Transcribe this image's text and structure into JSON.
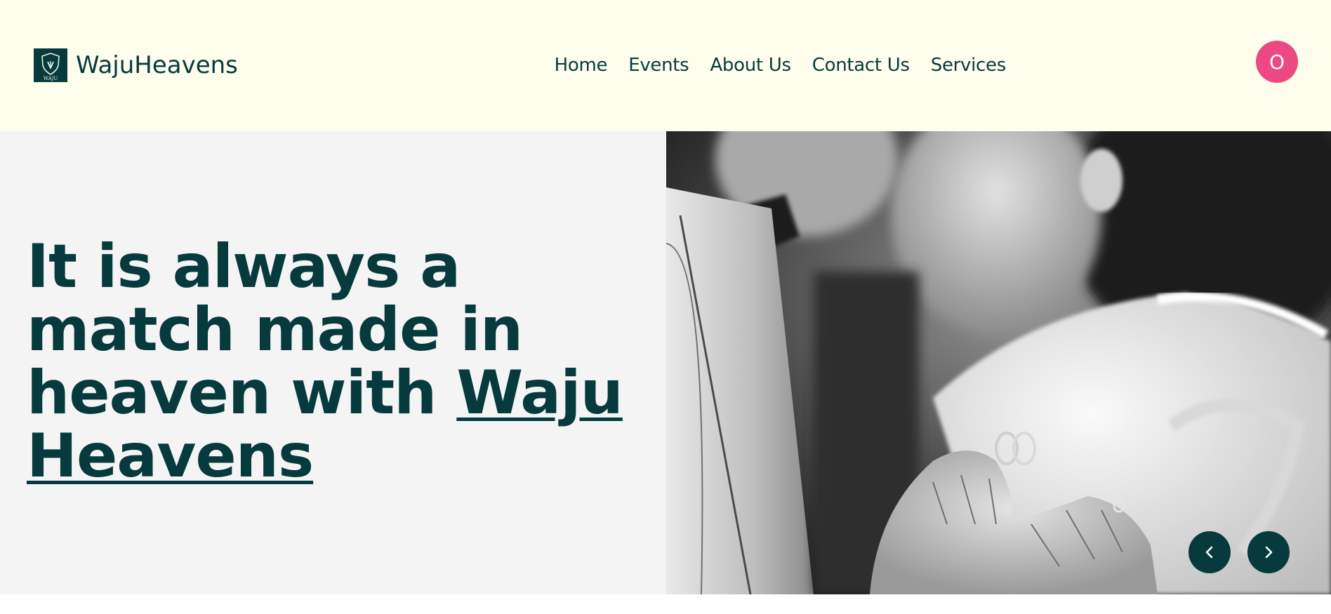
{
  "brand": {
    "name": "WajuHeavens",
    "logo_text": "WAJU"
  },
  "nav": {
    "items": [
      {
        "label": "Home"
      },
      {
        "label": "Events"
      },
      {
        "label": "About Us"
      },
      {
        "label": "Contact Us"
      },
      {
        "label": "Services"
      }
    ]
  },
  "user": {
    "avatar_initial": "O",
    "avatar_color": "#ec4882"
  },
  "hero": {
    "title_prefix": "It is always a match made in heaven with ",
    "title_link": "Waju Heavens",
    "image_semantic": "wedding-couple-ring-photo"
  },
  "carousel": {
    "prev_icon": "chevron-left-icon",
    "next_icon": "chevron-right-icon"
  },
  "colors": {
    "primary": "#063a3c",
    "header_bg": "#fffeec",
    "hero_bg": "#f4f4f5",
    "accent": "#ec4882"
  }
}
